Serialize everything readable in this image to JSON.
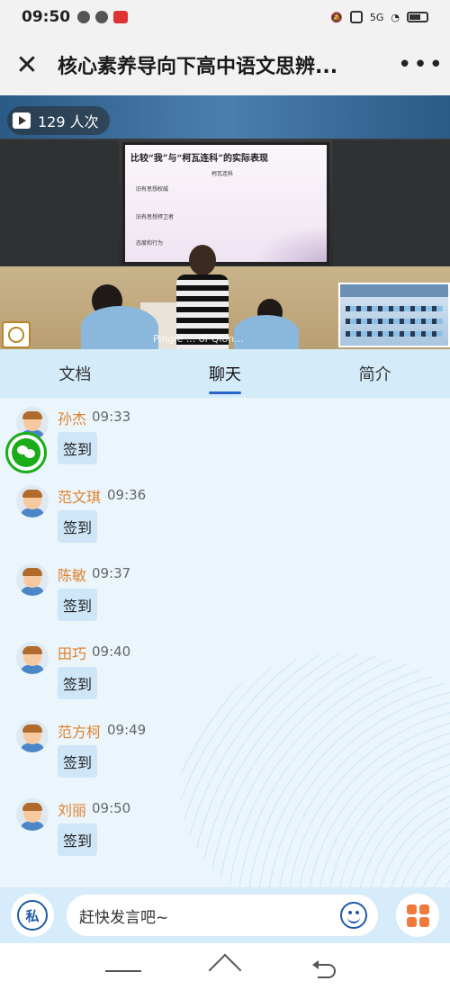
{
  "status_bar": {
    "time": "09:50",
    "network": "5G"
  },
  "header": {
    "title": "核心素养导向下高中语文思辨...",
    "close_icon": "close-icon",
    "more_label": "•••"
  },
  "video": {
    "views": "129 人次",
    "slide_title": "比较“我”与“柯瓦连科”的实际表现",
    "slide_subtitle": "柯瓦连科",
    "slide_lines": [
      "旧有思想权威",
      "旧有思想捍卫者",
      "态度和行为"
    ],
    "watermark": "Pingle ... of Qion..."
  },
  "tabs": [
    {
      "label": "文档",
      "active": false
    },
    {
      "label": "聊天",
      "active": true
    },
    {
      "label": "简介",
      "active": false
    }
  ],
  "messages": [
    {
      "name": "孙杰",
      "time": "09:33",
      "text": "签到"
    },
    {
      "name": "范文琪",
      "time": "09:36",
      "text": "签到"
    },
    {
      "name": "陈敏",
      "time": "09:37",
      "text": "签到"
    },
    {
      "name": "田巧",
      "time": "09:40",
      "text": "签到"
    },
    {
      "name": "范方柯",
      "time": "09:49",
      "text": "签到"
    },
    {
      "name": "刘丽",
      "time": "09:50",
      "text": "签到"
    }
  ],
  "input_bar": {
    "private_label": "私",
    "placeholder": "赶快发言吧~"
  },
  "colors": {
    "accent": "#2a66c9",
    "name": "#e0822c",
    "bubble": "#cfe6f8",
    "wechat": "#1aad19"
  }
}
